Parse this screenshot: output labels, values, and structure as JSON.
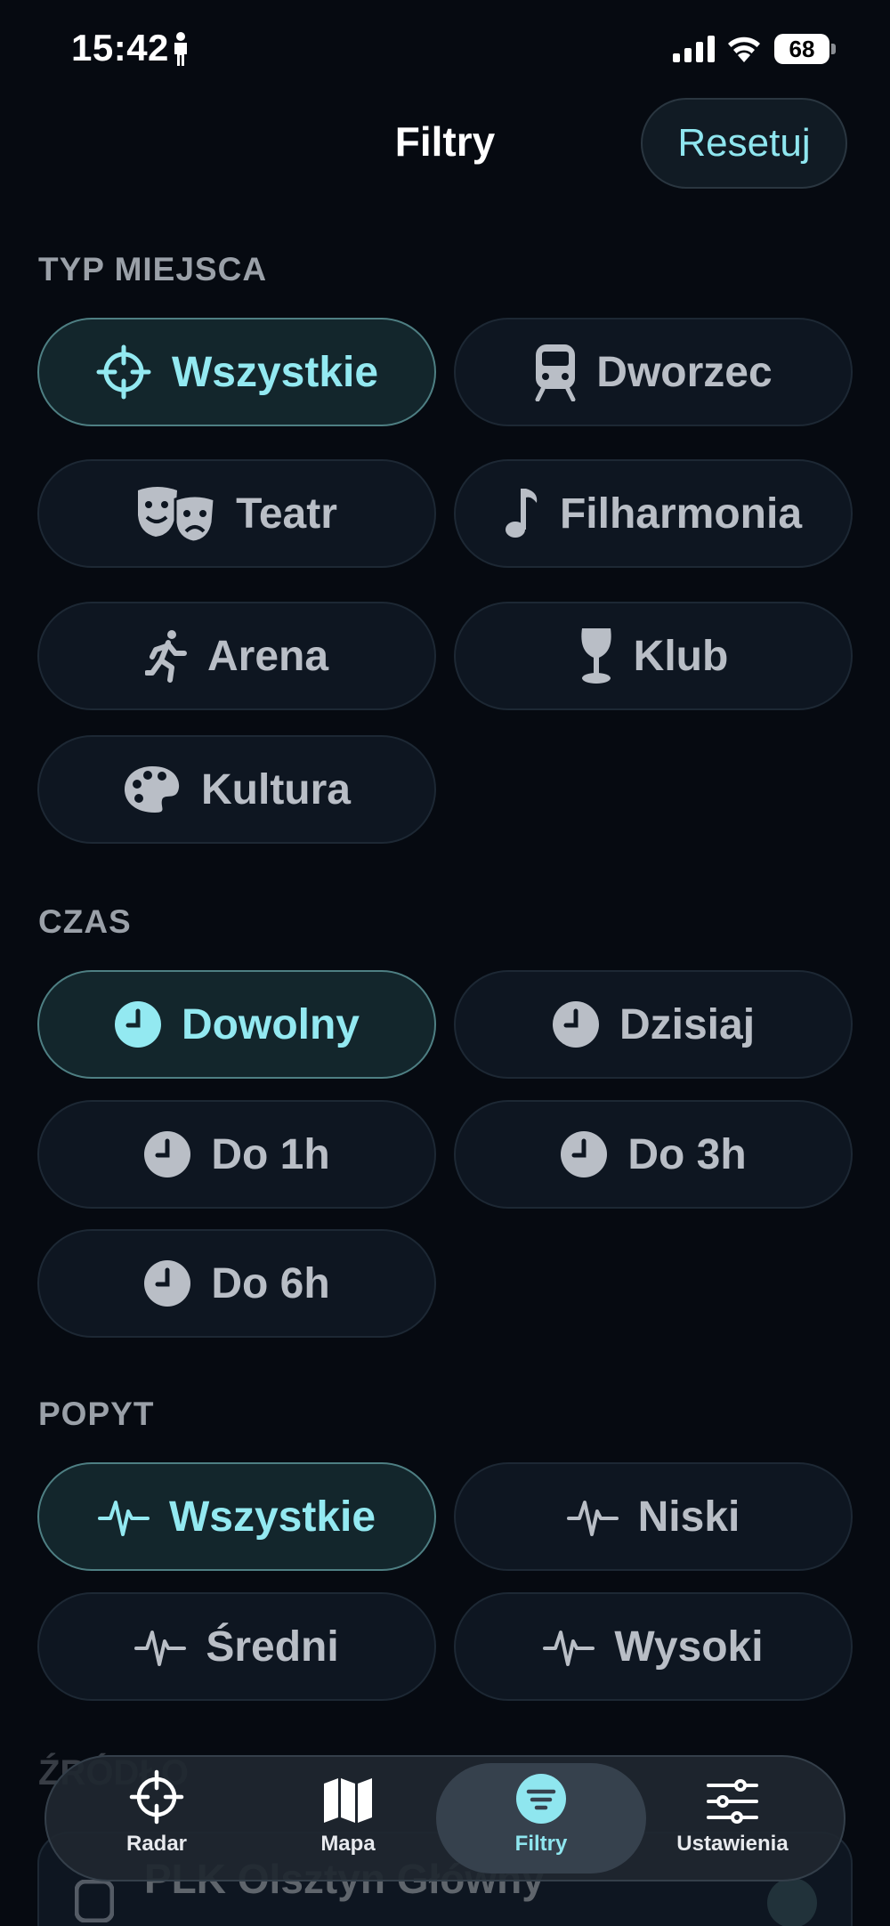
{
  "status_bar": {
    "time": "15:42",
    "battery": "68"
  },
  "header": {
    "title": "Filtry",
    "reset_label": "Resetuj"
  },
  "sections": {
    "place_type": {
      "label": "TYP MIEJSCA",
      "items": [
        {
          "label": "Wszystkie",
          "icon": "crosshair-icon",
          "selected": true
        },
        {
          "label": "Dworzec",
          "icon": "train-icon",
          "selected": false
        },
        {
          "label": "Teatr",
          "icon": "theater-masks-icon",
          "selected": false
        },
        {
          "label": "Filharmonia",
          "icon": "music-note-icon",
          "selected": false
        },
        {
          "label": "Arena",
          "icon": "running-figure-icon",
          "selected": false
        },
        {
          "label": "Klub",
          "icon": "wine-glass-icon",
          "selected": false
        },
        {
          "label": "Kultura",
          "icon": "palette-icon",
          "selected": false
        }
      ]
    },
    "time": {
      "label": "CZAS",
      "items": [
        {
          "label": "Dowolny",
          "icon": "clock-icon",
          "selected": true
        },
        {
          "label": "Dzisiaj",
          "icon": "clock-icon",
          "selected": false
        },
        {
          "label": "Do 1h",
          "icon": "clock-icon",
          "selected": false
        },
        {
          "label": "Do 3h",
          "icon": "clock-icon",
          "selected": false
        },
        {
          "label": "Do 6h",
          "icon": "clock-icon",
          "selected": false
        }
      ]
    },
    "demand": {
      "label": "POPYT",
      "items": [
        {
          "label": "Wszystkie",
          "icon": "pulse-icon",
          "selected": true
        },
        {
          "label": "Niski",
          "icon": "pulse-icon",
          "selected": false
        },
        {
          "label": "Średni",
          "icon": "pulse-icon",
          "selected": false
        },
        {
          "label": "Wysoki",
          "icon": "pulse-icon",
          "selected": false
        }
      ]
    },
    "source": {
      "label": "ŹRÓDŁO",
      "item": "PLK Olsztyn Główny"
    }
  },
  "tab_bar": {
    "items": [
      {
        "label": "Radar",
        "icon": "crosshair-icon",
        "selected": false
      },
      {
        "label": "Mapa",
        "icon": "map-icon",
        "selected": false
      },
      {
        "label": "Filtry",
        "icon": "filter-icon",
        "selected": true
      },
      {
        "label": "Ustawienia",
        "icon": "sliders-icon",
        "selected": false
      }
    ]
  },
  "colors": {
    "background": "#060a11",
    "accent": "#8fe6ef",
    "chip": "#0e1621",
    "chip_active": "#13262c"
  }
}
